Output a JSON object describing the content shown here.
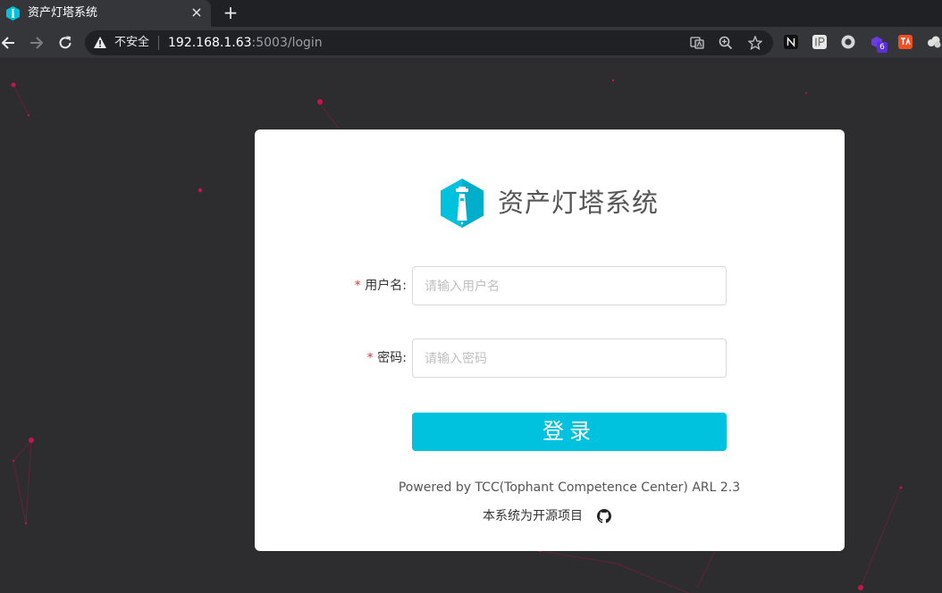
{
  "browser": {
    "tab": {
      "title": "资产灯塔系统",
      "close_symbol": "×"
    },
    "new_tab_symbol": "+",
    "security_label": "不安全",
    "url": {
      "host": "192.168.1.63",
      "rest": ":5003/login"
    },
    "extension_badge": "6"
  },
  "login": {
    "brand_title": "资产灯塔系统",
    "username": {
      "required_mark": "*",
      "label": "用户名:",
      "placeholder": "请输入用户名",
      "value": ""
    },
    "password": {
      "required_mark": "*",
      "label": "密码:",
      "placeholder": "请输入密码",
      "value": ""
    },
    "submit_label": "登录",
    "powered_by": "Powered by TCC(Tophant Competence Center) ARL 2.3",
    "open_source_note": "本系统为开源项目",
    "github_icon": "github-icon"
  },
  "colors": {
    "accent": "#00c1de",
    "page_bg": "#2d2c2f",
    "particle": "#c4174a"
  }
}
